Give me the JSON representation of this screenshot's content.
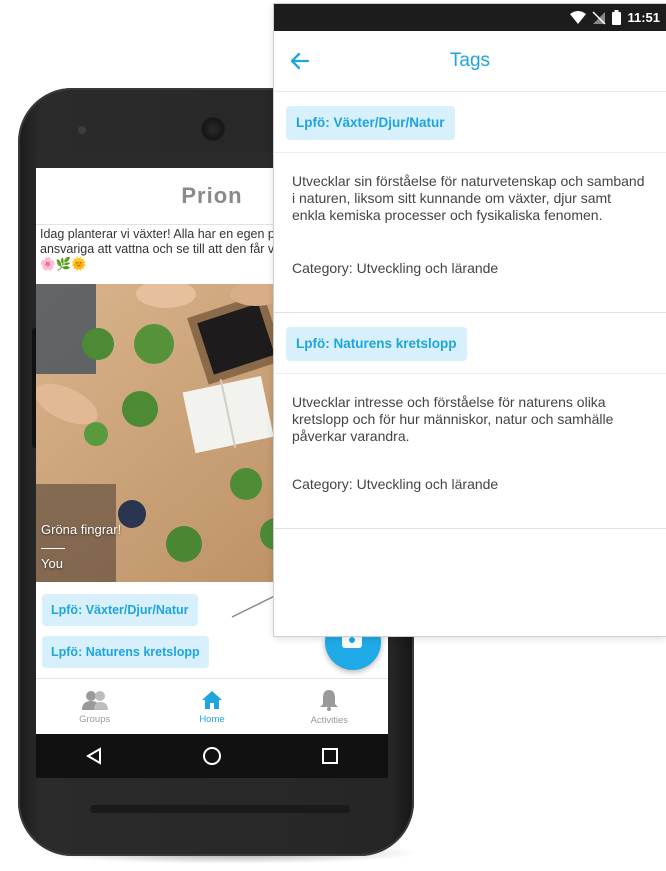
{
  "phone": {
    "app_title": "Prion",
    "post_text": "Idag planterar vi växter! Alla har en egen planta som de är ansvariga att vattna och se till att den får vatten och med ljus. 🌸🌿🌞",
    "image": {
      "caption": "Gröna fingrar!",
      "author": "You"
    },
    "tags": [
      "Lpfö: Växter/Djur/Natur",
      "Lpfö: Naturens kretslopp"
    ],
    "bottom_nav": [
      {
        "label": "Groups",
        "icon": "groups-icon",
        "active": false
      },
      {
        "label": "Home",
        "icon": "home-icon",
        "active": true
      },
      {
        "label": "Activities",
        "icon": "bell-icon",
        "active": false
      }
    ],
    "android_nav": [
      "back-icon",
      "home-circle-icon",
      "recents-icon"
    ]
  },
  "panel": {
    "status_time": "11:51",
    "title": "Tags",
    "tags": [
      {
        "name": "Lpfö: Växter/Djur/Natur",
        "description": "Utvecklar sin förståelse för naturvetenskap och samband i naturen, liksom sitt kunnande om växter, djur samt enkla kemiska processer och fysikaliska fenomen.",
        "category": "Category: Utveckling och lärande"
      },
      {
        "name": "Lpfö: Naturens kretslopp",
        "description": "Utvecklar intresse och förståelse för naturens olika kretslopp och för hur människor, natur och samhälle påverkar varandra.",
        "category": "Category: Utveckling och lärande"
      }
    ]
  },
  "colors": {
    "accent": "#1ea5dd",
    "chip_bg": "#d7f0fb",
    "fab": "#1fa9e6"
  }
}
